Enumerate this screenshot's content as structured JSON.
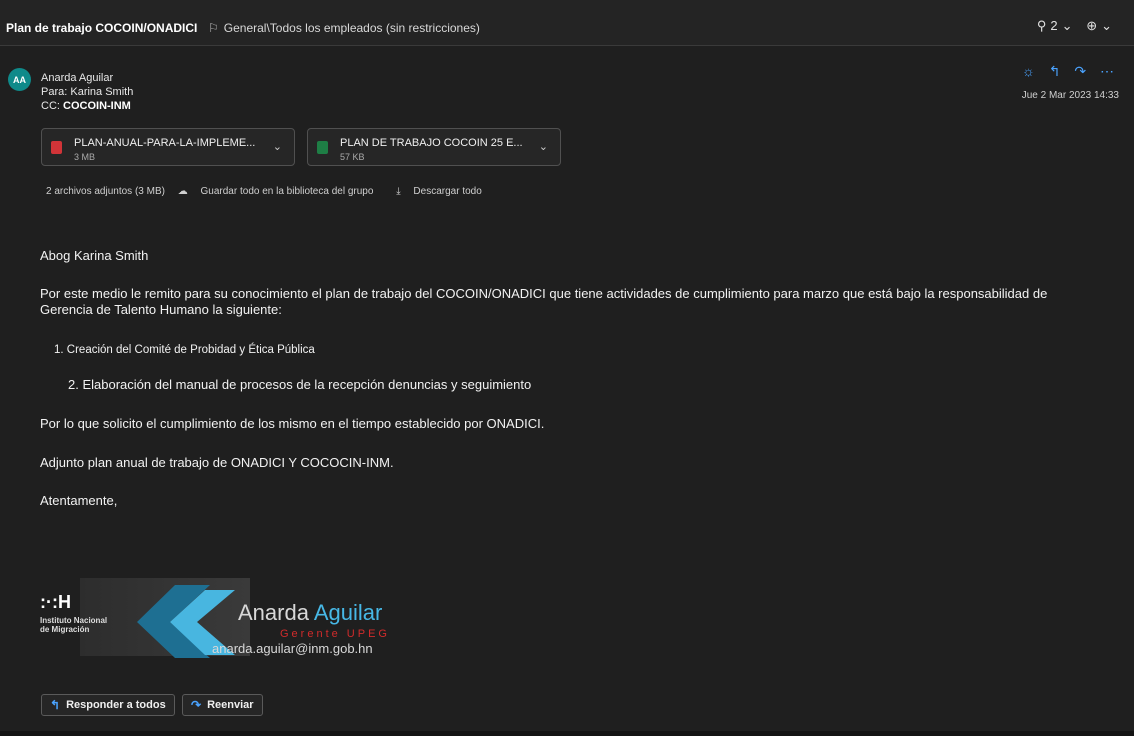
{
  "header": {
    "subject": "Plan de trabajo COCOIN/ONADICI",
    "sensitivity": "General\\Todos los empleados (sin restricciones)",
    "attachment_count": "2",
    "zoom_icon": "zoom-icon"
  },
  "message": {
    "avatar_initials": "AA",
    "from": "Anarda Aguilar",
    "to_label": "Para:",
    "to": "Karina Smith",
    "cc_label": "CC:",
    "cc": "COCOIN-INM",
    "datetime": "Jue 2 Mar 2023 14:33"
  },
  "attachments": [
    {
      "name": "PLAN-ANUAL-PARA-LA-IMPLEME...",
      "size": "3 MB",
      "type": "pdf",
      "color": "#d13438"
    },
    {
      "name": "PLAN DE TRABAJO COCOIN 25 E...",
      "size": "57 KB",
      "type": "xlsx",
      "color": "#1e7e45"
    }
  ],
  "attachment_summary": {
    "count_text": "2 archivos adjuntos (3 MB)",
    "save_all": "Guardar todo en la biblioteca del grupo",
    "download_all": "Descargar todo"
  },
  "body": {
    "greeting": "Abog Karina Smith",
    "para1": "Por este medio le remito para su conocimiento el plan de trabajo del COCOIN/ONADICI que tiene actividades de cumplimiento para marzo que está bajo la responsabilidad de Gerencia de Talento Humano la siguiente:",
    "item1": "1. Creación del Comité de Probidad y Ética Pública",
    "item2": "2. Elaboración del manual de procesos de la recepción denuncias y seguimiento",
    "para2": "Por lo que solicito el cumplimiento de los mismo en el tiempo establecido por ONADICI.",
    "para3": "Adjunto plan anual de trabajo de ONADICI Y COCOCIN-INM.",
    "closing": "Atentamente,"
  },
  "signature": {
    "logo_text": ":·:H",
    "institution_line1": "Instituto Nacional",
    "institution_line2": "de Migración",
    "first_name": "Anarda",
    "last_name": "Aguilar",
    "role": "Gerente UPEG",
    "email": "anarda.aguilar@inm.gob.hn"
  },
  "footer": {
    "reply_all": "Responder a todos",
    "forward": "Reenviar"
  },
  "colors": {
    "accent": "#4aa3ff",
    "avatar": "#0f8a8a",
    "background": "#1f1f1f"
  }
}
